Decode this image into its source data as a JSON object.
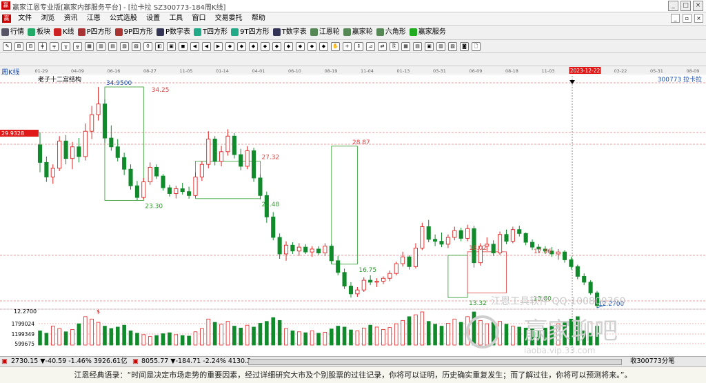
{
  "window": {
    "title": "赢家江恩专业版[赢家内部服务平台] - [拉卡拉  SZ300773-184周K线]",
    "logo": "赢"
  },
  "menu": [
    "文件",
    "浏览",
    "资讯",
    "江恩",
    "公式选股",
    "设置",
    "工具",
    "窗口",
    "交易委托",
    "帮助"
  ],
  "toolbar": [
    {
      "label": "行情",
      "icon": "grid-icon",
      "color": "#556"
    },
    {
      "label": "板块",
      "icon": "blocks-icon",
      "color": "#2a6"
    },
    {
      "label": "K线",
      "icon": "kline-icon",
      "color": "#c22"
    },
    {
      "label": "P四方形",
      "icon": "p-square-icon",
      "color": "#a33"
    },
    {
      "label": "9P四方形",
      "icon": "9p-square-icon",
      "color": "#a33"
    },
    {
      "label": "P数字表",
      "icon": "p-table-icon",
      "color": "#335"
    },
    {
      "label": "T四方形",
      "icon": "t-square-icon",
      "color": "#2a8"
    },
    {
      "label": "9T四方形",
      "icon": "9t-square-icon",
      "color": "#2a8"
    },
    {
      "label": "T数字表",
      "icon": "t-table-icon",
      "color": "#335"
    },
    {
      "label": "江恩轮",
      "icon": "gann-wheel-icon",
      "color": "#585"
    },
    {
      "label": "赢家轮",
      "icon": "winner-wheel-icon",
      "color": "#585"
    },
    {
      "label": "六角形",
      "icon": "hexagon-icon",
      "color": "#585"
    },
    {
      "label": "赢家服务",
      "icon": "dollar-icon",
      "color": "#2a2"
    }
  ],
  "chart_title": "周K线",
  "study_label": "老子十二宫结构",
  "symbol": "300773  拉卡拉",
  "current_price_tag": "29.9328",
  "timeline": {
    "dates": [
      "01-29",
      "04-09",
      "06-16",
      "08-27",
      "11-05",
      "01-14",
      "04-01",
      "06-10",
      "08-19",
      "11-04",
      "01-13",
      "03-31",
      "06-09",
      "08-18",
      "11-03",
      "2023-12-22",
      "03-22",
      "05-31",
      "08-09"
    ],
    "highlight": "2023-12-22"
  },
  "price_labels": [
    {
      "text": "34.9500",
      "price": 34.95,
      "week": 10,
      "color": "#1a4fb0"
    },
    {
      "text": "34.25",
      "price": 34.25,
      "week": 17,
      "color": "#e04040"
    },
    {
      "text": "28.87",
      "price": 28.87,
      "week": 48,
      "color": "#e04040"
    },
    {
      "text": "27.32",
      "price": 27.32,
      "week": 34,
      "color": "#e04040"
    },
    {
      "text": "23.30",
      "price": 23.3,
      "week": 16,
      "color": "#2a9a2a"
    },
    {
      "text": "23.48",
      "price": 23.48,
      "week": 34,
      "color": "#2a9a2a"
    },
    {
      "text": "16.75",
      "price": 16.75,
      "week": 49,
      "color": "#2a9a2a"
    },
    {
      "text": "18.02",
      "price": 18.02,
      "week": 66,
      "color": "#e04040"
    },
    {
      "text": "17.66",
      "price": 17.66,
      "week": 76,
      "color": "#e04040"
    },
    {
      "text": "13.32",
      "price": 13.32,
      "week": 66,
      "color": "#2a9a2a"
    },
    {
      "text": "13.80",
      "price": 13.8,
      "week": 76,
      "color": "#2a9a2a"
    },
    {
      "text": "12.2700",
      "price": 12.27,
      "week": 117,
      "color": "#1a4fb0"
    }
  ],
  "volume_axis": [
    "12.2700",
    "1799024",
    "1199349",
    "599675"
  ],
  "watermark": {
    "line1": "江恩工具软件 QQ:100800360",
    "line2": "赢家聊吧",
    "line3": "iaoba.vip.33.com"
  },
  "status": {
    "sh": "2730.15 ▼-40.59 -1.46% 3926.61亿",
    "sz": "8055.77 ▼-184.71 -2.24% 4130.2",
    "right": "收300773分笔"
  },
  "ticker": "江恩经典语录：“时间是决定市场走势的重要因素，经过详细研究大市及个别股票的过往记录，你将可以证明，历史确实重复发生；而了解过往，你将可以预测将来。”。",
  "colors": {
    "up": "#e02020",
    "down": "#108a2a",
    "grid": "#d04040",
    "bg": "#ffffff"
  },
  "chart_data": {
    "type": "candlestick",
    "title": "周K线",
    "period": "weekly",
    "price_range": [
      12.27,
      34.95
    ],
    "candles": [
      {
        "o": 29.0,
        "h": 30.3,
        "l": 26.2,
        "c": 27.2
      },
      {
        "o": 27.2,
        "h": 27.8,
        "l": 25.2,
        "c": 25.7
      },
      {
        "o": 25.7,
        "h": 27.0,
        "l": 25.0,
        "c": 26.6
      },
      {
        "o": 26.6,
        "h": 29.9,
        "l": 26.3,
        "c": 29.4
      },
      {
        "o": 29.4,
        "h": 30.0,
        "l": 27.0,
        "c": 27.6
      },
      {
        "o": 27.6,
        "h": 29.3,
        "l": 26.5,
        "c": 28.8
      },
      {
        "o": 28.8,
        "h": 29.7,
        "l": 27.2,
        "c": 27.8
      },
      {
        "o": 27.8,
        "h": 31.2,
        "l": 27.4,
        "c": 30.4
      },
      {
        "o": 30.4,
        "h": 33.0,
        "l": 29.6,
        "c": 32.1
      },
      {
        "o": 32.1,
        "h": 34.95,
        "l": 31.5,
        "c": 33.2
      },
      {
        "o": 33.2,
        "h": 33.7,
        "l": 29.2,
        "c": 29.7
      },
      {
        "o": 29.7,
        "h": 31.0,
        "l": 28.4,
        "c": 28.8
      },
      {
        "o": 28.8,
        "h": 29.6,
        "l": 27.3,
        "c": 27.7
      },
      {
        "o": 27.7,
        "h": 28.2,
        "l": 25.9,
        "c": 26.5
      },
      {
        "o": 26.5,
        "h": 27.0,
        "l": 24.4,
        "c": 24.8
      },
      {
        "o": 24.8,
        "h": 25.3,
        "l": 23.3,
        "c": 23.6
      },
      {
        "o": 23.6,
        "h": 25.6,
        "l": 23.4,
        "c": 25.2
      },
      {
        "o": 25.2,
        "h": 27.2,
        "l": 24.9,
        "c": 26.7
      },
      {
        "o": 26.7,
        "h": 27.0,
        "l": 25.5,
        "c": 25.8
      },
      {
        "o": 25.8,
        "h": 26.0,
        "l": 24.3,
        "c": 24.6
      },
      {
        "o": 24.6,
        "h": 24.9,
        "l": 23.7,
        "c": 24.0
      },
      {
        "o": 24.0,
        "h": 24.8,
        "l": 23.5,
        "c": 24.5
      },
      {
        "o": 24.5,
        "h": 25.1,
        "l": 23.9,
        "c": 24.2
      },
      {
        "o": 24.2,
        "h": 24.7,
        "l": 23.48,
        "c": 23.8
      },
      {
        "o": 23.8,
        "h": 26.2,
        "l": 23.6,
        "c": 25.7
      },
      {
        "o": 25.7,
        "h": 27.32,
        "l": 25.3,
        "c": 27.0
      },
      {
        "o": 27.0,
        "h": 30.4,
        "l": 26.6,
        "c": 29.6
      },
      {
        "o": 29.6,
        "h": 29.9,
        "l": 26.9,
        "c": 27.3
      },
      {
        "o": 27.3,
        "h": 28.9,
        "l": 26.8,
        "c": 28.3
      },
      {
        "o": 28.3,
        "h": 30.6,
        "l": 27.9,
        "c": 29.9
      },
      {
        "o": 29.9,
        "h": 30.2,
        "l": 27.6,
        "c": 28.0
      },
      {
        "o": 28.0,
        "h": 28.6,
        "l": 26.4,
        "c": 26.8
      },
      {
        "o": 26.8,
        "h": 28.87,
        "l": 26.5,
        "c": 28.4
      },
      {
        "o": 28.4,
        "h": 28.7,
        "l": 25.2,
        "c": 25.6
      },
      {
        "o": 25.6,
        "h": 26.0,
        "l": 23.4,
        "c": 23.8
      },
      {
        "o": 23.8,
        "h": 24.2,
        "l": 21.0,
        "c": 21.6
      },
      {
        "o": 21.6,
        "h": 22.1,
        "l": 19.2,
        "c": 19.5
      },
      {
        "o": 19.5,
        "h": 19.9,
        "l": 17.3,
        "c": 17.8
      },
      {
        "o": 17.8,
        "h": 19.1,
        "l": 17.1,
        "c": 18.7
      },
      {
        "o": 18.7,
        "h": 19.0,
        "l": 17.8,
        "c": 18.1
      },
      {
        "o": 18.1,
        "h": 18.9,
        "l": 17.6,
        "c": 18.5
      },
      {
        "o": 18.5,
        "h": 18.8,
        "l": 17.8,
        "c": 18.0
      },
      {
        "o": 18.0,
        "h": 18.6,
        "l": 17.5,
        "c": 18.3
      },
      {
        "o": 18.3,
        "h": 18.6,
        "l": 17.7,
        "c": 17.9
      },
      {
        "o": 17.9,
        "h": 18.9,
        "l": 17.6,
        "c": 18.6
      },
      {
        "o": 18.6,
        "h": 18.8,
        "l": 16.75,
        "c": 17.1
      },
      {
        "o": 17.1,
        "h": 17.6,
        "l": 15.6,
        "c": 15.9
      },
      {
        "o": 15.9,
        "h": 16.3,
        "l": 14.2,
        "c": 14.5
      },
      {
        "o": 14.5,
        "h": 14.9,
        "l": 13.32,
        "c": 13.7
      },
      {
        "o": 13.7,
        "h": 14.4,
        "l": 13.4,
        "c": 14.1
      },
      {
        "o": 14.1,
        "h": 15.4,
        "l": 13.9,
        "c": 15.1
      },
      {
        "o": 15.1,
        "h": 15.6,
        "l": 14.6,
        "c": 14.9
      },
      {
        "o": 14.9,
        "h": 15.3,
        "l": 14.4,
        "c": 15.0
      },
      {
        "o": 15.0,
        "h": 15.5,
        "l": 14.7,
        "c": 15.3
      },
      {
        "o": 15.3,
        "h": 16.1,
        "l": 15.0,
        "c": 15.8
      },
      {
        "o": 15.8,
        "h": 17.0,
        "l": 15.6,
        "c": 16.8
      },
      {
        "o": 16.8,
        "h": 18.02,
        "l": 16.5,
        "c": 17.5
      },
      {
        "o": 17.5,
        "h": 17.66,
        "l": 16.2,
        "c": 16.5
      },
      {
        "o": 16.5,
        "h": 18.9,
        "l": 16.3,
        "c": 18.4
      },
      {
        "o": 18.4,
        "h": 21.0,
        "l": 18.2,
        "c": 20.6
      },
      {
        "o": 20.6,
        "h": 21.3,
        "l": 19.0,
        "c": 19.3
      },
      {
        "o": 19.3,
        "h": 19.8,
        "l": 18.6,
        "c": 19.1
      },
      {
        "o": 19.1,
        "h": 20.0,
        "l": 18.5,
        "c": 18.8
      },
      {
        "o": 18.8,
        "h": 19.8,
        "l": 18.4,
        "c": 19.5
      },
      {
        "o": 19.5,
        "h": 20.6,
        "l": 19.2,
        "c": 20.2
      },
      {
        "o": 20.2,
        "h": 20.5,
        "l": 19.1,
        "c": 19.4
      },
      {
        "o": 19.4,
        "h": 20.8,
        "l": 19.1,
        "c": 20.4
      },
      {
        "o": 20.4,
        "h": 20.7,
        "l": 16.4,
        "c": 16.9
      },
      {
        "o": 16.9,
        "h": 18.9,
        "l": 16.6,
        "c": 18.6
      },
      {
        "o": 18.6,
        "h": 19.5,
        "l": 18.1,
        "c": 18.8
      },
      {
        "o": 18.8,
        "h": 19.2,
        "l": 17.6,
        "c": 17.9
      },
      {
        "o": 17.9,
        "h": 20.1,
        "l": 17.7,
        "c": 19.8
      },
      {
        "o": 19.8,
        "h": 20.3,
        "l": 18.8,
        "c": 19.1
      },
      {
        "o": 19.1,
        "h": 20.6,
        "l": 18.9,
        "c": 20.3
      },
      {
        "o": 20.3,
        "h": 20.7,
        "l": 19.6,
        "c": 19.9
      },
      {
        "o": 19.9,
        "h": 20.0,
        "l": 18.7,
        "c": 19.0
      },
      {
        "o": 19.0,
        "h": 19.3,
        "l": 18.2,
        "c": 18.5
      },
      {
        "o": 18.5,
        "h": 18.8,
        "l": 17.9,
        "c": 18.3
      },
      {
        "o": 18.3,
        "h": 18.6,
        "l": 17.8,
        "c": 18.1
      },
      {
        "o": 18.1,
        "h": 18.5,
        "l": 17.5,
        "c": 17.8
      },
      {
        "o": 17.8,
        "h": 18.3,
        "l": 17.2,
        "c": 18.0
      },
      {
        "o": 18.0,
        "h": 18.2,
        "l": 16.9,
        "c": 17.2
      },
      {
        "o": 17.2,
        "h": 17.5,
        "l": 16.2,
        "c": 16.5
      },
      {
        "o": 16.5,
        "h": 16.7,
        "l": 15.2,
        "c": 15.5
      },
      {
        "o": 15.5,
        "h": 15.8,
        "l": 14.6,
        "c": 14.9
      },
      {
        "o": 14.9,
        "h": 15.1,
        "l": 13.6,
        "c": 13.8
      },
      {
        "o": 13.8,
        "h": 14.0,
        "l": 12.27,
        "c": 12.5
      }
    ],
    "volume": [
      30,
      25,
      40,
      35,
      28,
      33,
      45,
      60,
      55,
      48,
      40,
      35,
      38,
      42,
      30,
      25,
      22,
      18,
      20,
      24,
      26,
      22,
      20,
      19,
      28,
      35,
      55,
      48,
      44,
      50,
      40,
      36,
      42,
      38,
      46,
      50,
      58,
      52,
      35,
      30,
      28,
      26,
      30,
      25,
      27,
      34,
      40,
      38,
      32,
      30,
      36,
      42,
      38,
      33,
      37,
      45,
      52,
      60,
      64,
      70,
      50,
      44,
      40,
      46,
      55,
      48,
      60,
      70,
      52,
      45,
      48,
      50,
      44,
      40,
      38,
      36,
      34,
      30,
      36,
      40,
      45,
      50,
      55,
      60
    ]
  }
}
